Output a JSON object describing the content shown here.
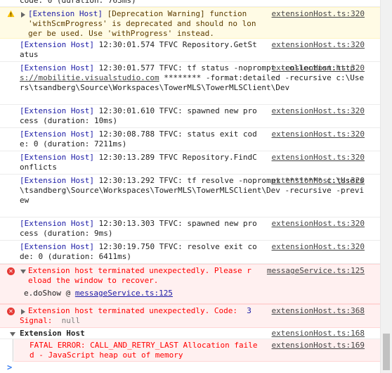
{
  "entries": [
    {
      "kind": "clip",
      "msg": "code: 0 (duration: 763ms)"
    },
    {
      "kind": "warn",
      "prefix": "[Extension Host]",
      "msg": " [Deprecation Warning] function 'withScmProgress' is deprecated and should no longer be used. Use 'withProgress' instead.",
      "src": "extensionHost.ts:320"
    },
    {
      "kind": "log",
      "prefix": "[Extension Host]",
      "msg": " 12:30:01.574 TFVC Repository.GetStatus",
      "src": "extensionHost.ts:320"
    },
    {
      "kind": "log-link",
      "prefix": "[Extension Host]",
      "msg1": " 12:30:01.577 TFVC: tf status -noprompt -collection:",
      "link": "https://mobilitie.visualstudio.com",
      "msg2": " ******** -format:detailed -recursive c:\\Users\\tsandberg\\Source\\Workspaces\\TowerMLS\\TowerMLSClient\\Dev",
      "src": "extensionHost.ts:320"
    },
    {
      "kind": "log",
      "prefix": "[Extension Host]",
      "msg": " 12:30:01.610 TFVC: spawned new process (duration: 10ms)",
      "src": "extensionHost.ts:320"
    },
    {
      "kind": "log",
      "prefix": "[Extension Host]",
      "msg": " 12:30:08.788 TFVC: status exit code: 0 (duration: 7211ms)",
      "src": "extensionHost.ts:320"
    },
    {
      "kind": "log",
      "prefix": "[Extension Host]",
      "msg": " 12:30:13.289 TFVC Repository.FindConflicts",
      "src": "extensionHost.ts:320"
    },
    {
      "kind": "log",
      "prefix": "[Extension Host]",
      "msg": " 12:30:13.292 TFVC: tf resolve -noprompt ******** c:\\Users\\tsandberg\\Source\\Workspaces\\TowerMLS\\TowerMLSClient\\Dev -recursive -preview",
      "src": "extensionHost.ts:320"
    },
    {
      "kind": "log",
      "prefix": "[Extension Host]",
      "msg": " 12:30:13.303 TFVC: spawned new process (duration: 9ms)",
      "src": "extensionHost.ts:320"
    },
    {
      "kind": "log",
      "prefix": "[Extension Host]",
      "msg": " 12:30:19.750 TFVC: resolve exit code: 0 (duration: 6411ms)",
      "src": "extensionHost.ts:320"
    }
  ],
  "error1": {
    "msg": "Extension host terminated unexpectedly. Please reload the window to recover.",
    "src": "messageService.ts:125",
    "stack_prefix": "e.doShow @ ",
    "stack_link": "messageService.ts:125"
  },
  "error2": {
    "msg": "Extension host terminated unexpectedly. Code:",
    "code": "3",
    "signal_label": "Signal:",
    "signal_value": "null",
    "src": "extensionHost.ts:368"
  },
  "group": {
    "title": "Extension Host",
    "src": "extensionHost.ts:168",
    "error_msg": "FATAL ERROR: CALL_AND_RETRY_LAST Allocation failed - JavaScript heap out of memory",
    "error_src": "extensionHost.ts:169"
  },
  "prompt": ">"
}
